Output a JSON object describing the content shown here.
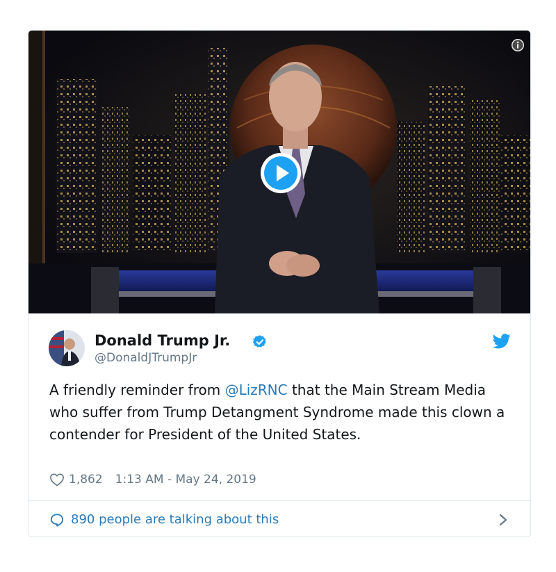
{
  "tweet": {
    "author_name": "Donald Trump Jr.",
    "author_handle": "@DonaldJTrumpJr",
    "text_before": "A friendly reminder from ",
    "mention": "@LizRNC",
    "text_after": " that the Main Stream Media who suffer from Trump Detangment Syndrome made this clown a contender for President of the United States.",
    "likes": "1,862",
    "timestamp": "1:13 AM - May 24, 2019"
  },
  "footer": {
    "talking": "890 people are talking about this"
  },
  "icons": {
    "info": "info-icon",
    "play": "play-icon",
    "verified": "verified-badge-icon",
    "brand": "twitter-bird-icon",
    "like": "heart-icon",
    "reply": "speech-bubble-icon",
    "more": "chevron-right-icon"
  },
  "colors": {
    "brand_blue": "#1da1f2",
    "link_blue": "#2b7bb9",
    "secondary_text": "#657786",
    "border": "#e1e8ed"
  }
}
